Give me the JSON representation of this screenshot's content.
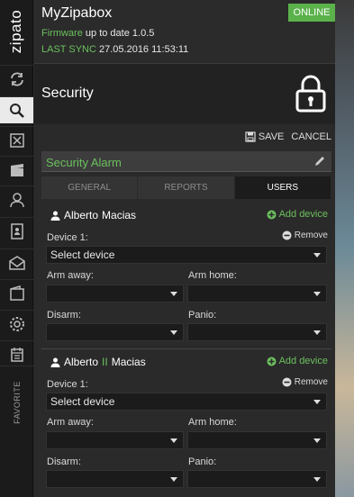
{
  "brand": {
    "logo_text": "zipato"
  },
  "header": {
    "app_title": "MyZipabox",
    "status": "ONLINE",
    "firmware_label": "Firmware",
    "firmware_value": "up to date 1.0.5",
    "sync_label": "LAST SYNC",
    "sync_value": "27.05.2016 11:53:11"
  },
  "rail": {
    "items": [
      "sync-icon",
      "search-icon",
      "devices-icon",
      "scenes-icon",
      "users-icon",
      "contacts-icon",
      "messages-icon",
      "wallet-icon",
      "settings-icon",
      "calendar-icon"
    ],
    "active": "search-icon",
    "favorite_label": "FAVORITE"
  },
  "section": {
    "title": "Security"
  },
  "toolbar": {
    "save_label": "SAVE",
    "cancel_label": "CANCEL"
  },
  "alarm": {
    "name": "Security Alarm"
  },
  "tabs": [
    {
      "label": "GENERAL",
      "active": false
    },
    {
      "label": "REPORTS",
      "active": false
    },
    {
      "label": "USERS",
      "active": true
    }
  ],
  "users": [
    {
      "name_part1": "Alberto",
      "name_part2": "Macias",
      "name_mid": "",
      "add_device": "Add device",
      "device_label": "Device 1:",
      "remove_label": "Remove",
      "device_value": "Select device",
      "arm_away_label": "Arm away:",
      "arm_home_label": "Arm home:",
      "disarm_label": "Disarm:",
      "panic_label": "Panio:"
    },
    {
      "name_part1": "Alberto",
      "name_part2": "Macias",
      "name_mid": "II",
      "add_device": "Add device",
      "device_label": "Device 1:",
      "remove_label": "Remove",
      "device_value": "Select device",
      "arm_away_label": "Arm away:",
      "arm_home_label": "Arm home:",
      "disarm_label": "Disarm:",
      "panic_label": "Panio:"
    }
  ],
  "colors": {
    "accent": "#6cc05e",
    "online_bg": "#5bb24b",
    "rail_bg": "#1b1b1b",
    "panel_bg": "#2a2a2a"
  }
}
